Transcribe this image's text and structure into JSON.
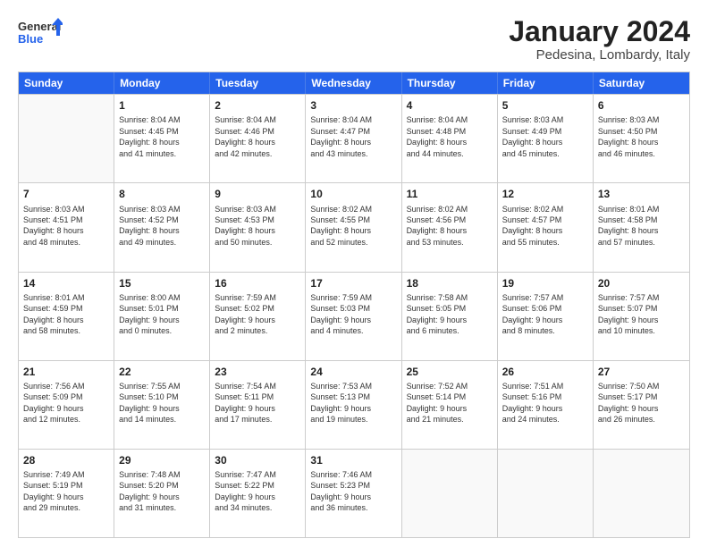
{
  "header": {
    "logo_general": "General",
    "logo_blue": "Blue",
    "month_title": "January 2024",
    "subtitle": "Pedesina, Lombardy, Italy"
  },
  "days_of_week": [
    "Sunday",
    "Monday",
    "Tuesday",
    "Wednesday",
    "Thursday",
    "Friday",
    "Saturday"
  ],
  "weeks": [
    [
      {
        "num": "",
        "info": "",
        "empty": true
      },
      {
        "num": "1",
        "info": "Sunrise: 8:04 AM\nSunset: 4:45 PM\nDaylight: 8 hours\nand 41 minutes."
      },
      {
        "num": "2",
        "info": "Sunrise: 8:04 AM\nSunset: 4:46 PM\nDaylight: 8 hours\nand 42 minutes."
      },
      {
        "num": "3",
        "info": "Sunrise: 8:04 AM\nSunset: 4:47 PM\nDaylight: 8 hours\nand 43 minutes."
      },
      {
        "num": "4",
        "info": "Sunrise: 8:04 AM\nSunset: 4:48 PM\nDaylight: 8 hours\nand 44 minutes."
      },
      {
        "num": "5",
        "info": "Sunrise: 8:03 AM\nSunset: 4:49 PM\nDaylight: 8 hours\nand 45 minutes."
      },
      {
        "num": "6",
        "info": "Sunrise: 8:03 AM\nSunset: 4:50 PM\nDaylight: 8 hours\nand 46 minutes."
      }
    ],
    [
      {
        "num": "7",
        "info": "Sunrise: 8:03 AM\nSunset: 4:51 PM\nDaylight: 8 hours\nand 48 minutes."
      },
      {
        "num": "8",
        "info": "Sunrise: 8:03 AM\nSunset: 4:52 PM\nDaylight: 8 hours\nand 49 minutes."
      },
      {
        "num": "9",
        "info": "Sunrise: 8:03 AM\nSunset: 4:53 PM\nDaylight: 8 hours\nand 50 minutes."
      },
      {
        "num": "10",
        "info": "Sunrise: 8:02 AM\nSunset: 4:55 PM\nDaylight: 8 hours\nand 52 minutes."
      },
      {
        "num": "11",
        "info": "Sunrise: 8:02 AM\nSunset: 4:56 PM\nDaylight: 8 hours\nand 53 minutes."
      },
      {
        "num": "12",
        "info": "Sunrise: 8:02 AM\nSunset: 4:57 PM\nDaylight: 8 hours\nand 55 minutes."
      },
      {
        "num": "13",
        "info": "Sunrise: 8:01 AM\nSunset: 4:58 PM\nDaylight: 8 hours\nand 57 minutes."
      }
    ],
    [
      {
        "num": "14",
        "info": "Sunrise: 8:01 AM\nSunset: 4:59 PM\nDaylight: 8 hours\nand 58 minutes."
      },
      {
        "num": "15",
        "info": "Sunrise: 8:00 AM\nSunset: 5:01 PM\nDaylight: 9 hours\nand 0 minutes."
      },
      {
        "num": "16",
        "info": "Sunrise: 7:59 AM\nSunset: 5:02 PM\nDaylight: 9 hours\nand 2 minutes."
      },
      {
        "num": "17",
        "info": "Sunrise: 7:59 AM\nSunset: 5:03 PM\nDaylight: 9 hours\nand 4 minutes."
      },
      {
        "num": "18",
        "info": "Sunrise: 7:58 AM\nSunset: 5:05 PM\nDaylight: 9 hours\nand 6 minutes."
      },
      {
        "num": "19",
        "info": "Sunrise: 7:57 AM\nSunset: 5:06 PM\nDaylight: 9 hours\nand 8 minutes."
      },
      {
        "num": "20",
        "info": "Sunrise: 7:57 AM\nSunset: 5:07 PM\nDaylight: 9 hours\nand 10 minutes."
      }
    ],
    [
      {
        "num": "21",
        "info": "Sunrise: 7:56 AM\nSunset: 5:09 PM\nDaylight: 9 hours\nand 12 minutes."
      },
      {
        "num": "22",
        "info": "Sunrise: 7:55 AM\nSunset: 5:10 PM\nDaylight: 9 hours\nand 14 minutes."
      },
      {
        "num": "23",
        "info": "Sunrise: 7:54 AM\nSunset: 5:11 PM\nDaylight: 9 hours\nand 17 minutes."
      },
      {
        "num": "24",
        "info": "Sunrise: 7:53 AM\nSunset: 5:13 PM\nDaylight: 9 hours\nand 19 minutes."
      },
      {
        "num": "25",
        "info": "Sunrise: 7:52 AM\nSunset: 5:14 PM\nDaylight: 9 hours\nand 21 minutes."
      },
      {
        "num": "26",
        "info": "Sunrise: 7:51 AM\nSunset: 5:16 PM\nDaylight: 9 hours\nand 24 minutes."
      },
      {
        "num": "27",
        "info": "Sunrise: 7:50 AM\nSunset: 5:17 PM\nDaylight: 9 hours\nand 26 minutes."
      }
    ],
    [
      {
        "num": "28",
        "info": "Sunrise: 7:49 AM\nSunset: 5:19 PM\nDaylight: 9 hours\nand 29 minutes."
      },
      {
        "num": "29",
        "info": "Sunrise: 7:48 AM\nSunset: 5:20 PM\nDaylight: 9 hours\nand 31 minutes."
      },
      {
        "num": "30",
        "info": "Sunrise: 7:47 AM\nSunset: 5:22 PM\nDaylight: 9 hours\nand 34 minutes."
      },
      {
        "num": "31",
        "info": "Sunrise: 7:46 AM\nSunset: 5:23 PM\nDaylight: 9 hours\nand 36 minutes."
      },
      {
        "num": "",
        "info": "",
        "empty": true
      },
      {
        "num": "",
        "info": "",
        "empty": true
      },
      {
        "num": "",
        "info": "",
        "empty": true
      }
    ]
  ]
}
